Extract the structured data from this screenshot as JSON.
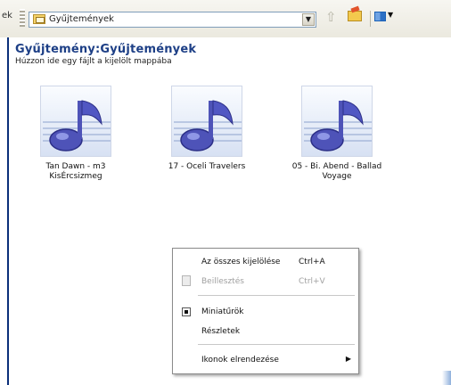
{
  "toolbar": {
    "address_text": "Gyűjtemények",
    "up_icon": "folder-up-icon",
    "folder_icon": "folders-icon",
    "views_icon": "views-menu-icon"
  },
  "main": {
    "title": "Gyűjtemény:Gyűjtemények",
    "subtitle": "Húzzon ide egy fájlt a kijelölt mappába"
  },
  "items": [
    {
      "label": "Tan Dawn - m3 KisÉrcsizmeg"
    },
    {
      "label": "17 - Oceli Travelers"
    },
    {
      "label": "05 - Bi. Abend - Ballad Voyage"
    }
  ],
  "menu": {
    "items": [
      {
        "label": "Az összes kijelölése",
        "shortcut": "Ctrl+A",
        "enabled": true
      },
      {
        "label": "Beillesztés",
        "shortcut": "Ctrl+V",
        "enabled": false
      },
      {
        "label": "Miniatűrök",
        "checked": true
      },
      {
        "label": "Részletek"
      },
      {
        "label": "Ikonok elrendezése",
        "has_submenu": true
      }
    ]
  }
}
